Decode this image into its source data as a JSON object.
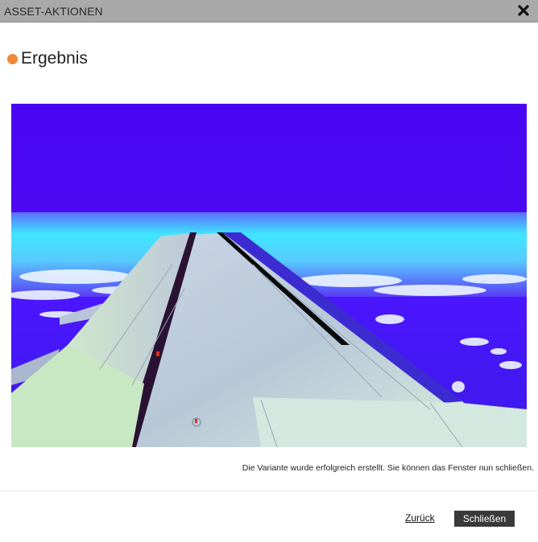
{
  "dialog": {
    "title": "ASSET-AKTIONEN",
    "close_icon": "close-x-icon"
  },
  "result": {
    "heading": "Ergebnis",
    "status_dot_color": "#f08a3a",
    "image_icon": "airplane-wing-over-clouds-image",
    "message": "Die Variante wurde erfolgreich erstellt. Sie können das Fenster nun schließen."
  },
  "footer": {
    "back_label": "Zurück",
    "close_label": "Schließen",
    "close_button_color": "#3a3a3a"
  }
}
